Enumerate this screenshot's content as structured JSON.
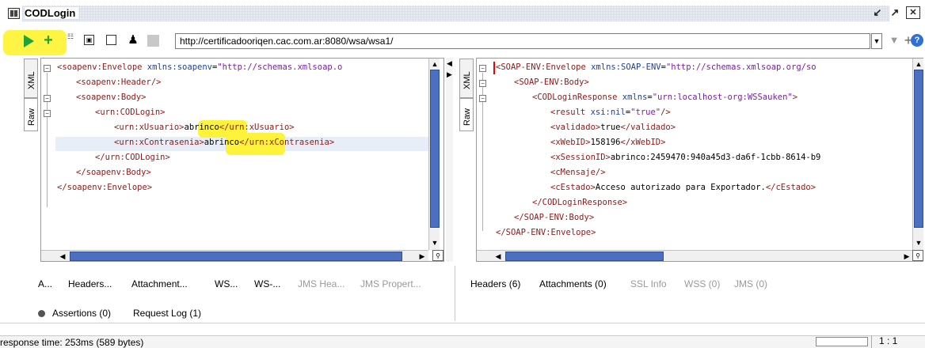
{
  "window": {
    "title": "CODLogin"
  },
  "toolbar": {
    "url": "http://certificadooriqen.cac.com.ar:8080/wsa/wsa1/"
  },
  "request": {
    "side_tabs": [
      "XML",
      "Raw"
    ],
    "lines": [
      {
        "parts": [
          {
            "c": "tag",
            "t": "<soapenv:Envelope "
          },
          {
            "c": "attr",
            "t": "xmlns:soapenv"
          },
          {
            "c": "txt",
            "t": "="
          },
          {
            "c": "str",
            "t": "\"http://schemas.xmlsoap.o"
          }
        ]
      },
      {
        "parts": [
          {
            "c": "tag",
            "t": "<soapenv:Header/>"
          }
        ]
      },
      {
        "parts": [
          {
            "c": "tag",
            "t": "<soapenv:Body>"
          }
        ]
      },
      {
        "parts": [
          {
            "c": "tag",
            "t": "<urn:CODLogin>"
          }
        ]
      },
      {
        "parts": [
          {
            "c": "tag",
            "t": "<urn:xUsuario>"
          },
          {
            "c": "txt",
            "t": "abrinco"
          },
          {
            "c": "tag",
            "t": "</urn:xUsuario>"
          }
        ]
      },
      {
        "parts": [
          {
            "c": "tag",
            "t": "<urn:xContrasenia>"
          },
          {
            "c": "txt",
            "t": "abrinco"
          },
          {
            "c": "tag",
            "t": "</urn:xContrasenia>"
          }
        ]
      },
      {
        "parts": [
          {
            "c": "tag",
            "t": "</urn:CODLogin>"
          }
        ]
      },
      {
        "parts": [
          {
            "c": "tag",
            "t": "</soapenv:Body>"
          }
        ]
      },
      {
        "parts": [
          {
            "c": "tag",
            "t": "</soapenv:Envelope>"
          }
        ]
      }
    ]
  },
  "response": {
    "side_tabs": [
      "XML",
      "Raw"
    ],
    "lines": [
      {
        "parts": [
          {
            "c": "tag",
            "t": "<SOAP-ENV:Envelope "
          },
          {
            "c": "attr",
            "t": "xmlns:SOAP-ENV"
          },
          {
            "c": "txt",
            "t": "="
          },
          {
            "c": "str",
            "t": "\"http://schemas.xmlsoap.org/so"
          }
        ]
      },
      {
        "parts": [
          {
            "c": "tag",
            "t": "<SOAP-ENV:Body>"
          }
        ]
      },
      {
        "parts": [
          {
            "c": "tag",
            "t": "<CODLoginResponse "
          },
          {
            "c": "attr",
            "t": "xmlns"
          },
          {
            "c": "txt",
            "t": "="
          },
          {
            "c": "str",
            "t": "\"urn:localhost-org:WSSauken\""
          },
          {
            "c": "tag",
            "t": ">"
          }
        ]
      },
      {
        "parts": [
          {
            "c": "tag",
            "t": "<result "
          },
          {
            "c": "attr",
            "t": "xsi:nil"
          },
          {
            "c": "txt",
            "t": "="
          },
          {
            "c": "str",
            "t": "\"true\""
          },
          {
            "c": "tag",
            "t": "/>"
          }
        ]
      },
      {
        "parts": [
          {
            "c": "tag",
            "t": "<validado>"
          },
          {
            "c": "txt",
            "t": "true"
          },
          {
            "c": "tag",
            "t": "</validado>"
          }
        ]
      },
      {
        "parts": [
          {
            "c": "tag",
            "t": "<xWebID>"
          },
          {
            "c": "txt",
            "t": "158196"
          },
          {
            "c": "tag",
            "t": "</xWebID>"
          }
        ]
      },
      {
        "parts": [
          {
            "c": "tag",
            "t": "<xSessionID>"
          },
          {
            "c": "txt",
            "t": "abrinco:2459470:940a45d3-da6f-1cbb-8614-b9"
          }
        ]
      },
      {
        "parts": [
          {
            "c": "tag",
            "t": "<cMensaje/>"
          }
        ]
      },
      {
        "parts": [
          {
            "c": "tag",
            "t": "<cEstado>"
          },
          {
            "c": "txt",
            "t": "Acceso autorizado para Exportador."
          },
          {
            "c": "tag",
            "t": "</cEstado>"
          }
        ]
      },
      {
        "parts": [
          {
            "c": "tag",
            "t": "</CODLoginResponse>"
          }
        ]
      },
      {
        "parts": [
          {
            "c": "tag",
            "t": "</SOAP-ENV:Body>"
          }
        ]
      },
      {
        "parts": [
          {
            "c": "tag",
            "t": "</SOAP-ENV:Envelope>"
          }
        ]
      }
    ]
  },
  "request_tabs": [
    "A...",
    "Headers...",
    "Attachment...",
    "WS...",
    "WS-...",
    "JMS Hea...",
    "JMS Propert..."
  ],
  "response_tabs": [
    "Headers (6)",
    "Attachments (0)",
    "SSL Info",
    "WSS (0)",
    "JMS (0)"
  ],
  "assertions": {
    "assertions_label": "Assertions (0)",
    "request_log_label": "Request Log (1)"
  },
  "status": {
    "response_time": "response time: 253ms (589 bytes)",
    "position": "1 : 1"
  },
  "highlight_color": "#fdf33a"
}
